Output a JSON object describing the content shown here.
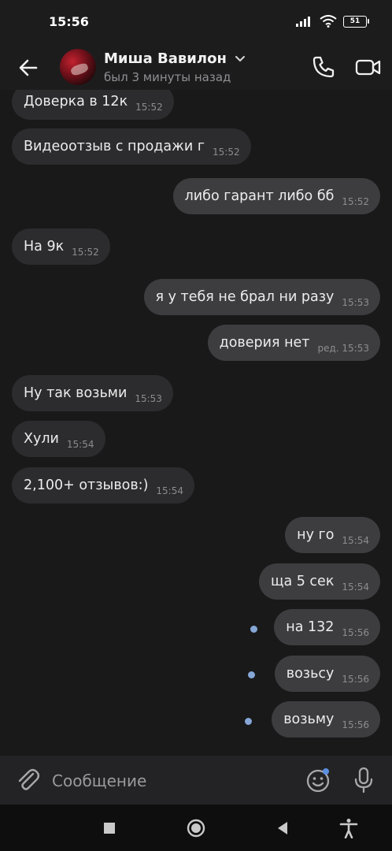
{
  "status_bar": {
    "time": "15:56",
    "battery": "51"
  },
  "header": {
    "contact_name": "Миша Вавилон",
    "contact_status": "был 3 минуты назад"
  },
  "messages": [
    {
      "dir": "in",
      "text": "Доверка в 12к",
      "time": "15:52"
    },
    {
      "dir": "in",
      "text": "Видеоотзыв с продажи г",
      "time": "15:52"
    },
    {
      "dir": "out",
      "text": "либо гарант либо бб",
      "time": "15:52"
    },
    {
      "dir": "in",
      "text": "На 9к",
      "time": "15:52"
    },
    {
      "dir": "out",
      "text": "я у тебя не брал ни разу",
      "time": "15:53"
    },
    {
      "dir": "out",
      "text": "доверия нет",
      "time": "ред. 15:53"
    },
    {
      "dir": "in",
      "text": "Ну так возьми",
      "time": "15:53"
    },
    {
      "dir": "in",
      "text": "Хули",
      "time": "15:54"
    },
    {
      "dir": "in",
      "text": "2,100+ отзывов:)",
      "time": "15:54"
    },
    {
      "dir": "out",
      "text": "ну го",
      "time": "15:54"
    },
    {
      "dir": "out",
      "text": "ща 5 сек",
      "time": "15:54"
    },
    {
      "dir": "out",
      "text": "на 132",
      "time": "15:56",
      "unread": true
    },
    {
      "dir": "out",
      "text": "возьсу",
      "time": "15:56",
      "unread": true
    },
    {
      "dir": "out",
      "text": "возьму",
      "time": "15:56",
      "unread": true
    }
  ],
  "composer": {
    "placeholder": "Сообщение"
  },
  "icons": {
    "back": "arrow-left-icon",
    "call": "phone-icon",
    "video": "video-camera-icon",
    "attach": "paperclip-icon",
    "emoji": "smiley-icon",
    "mic": "microphone-icon",
    "nav": [
      "square-icon",
      "circle-icon",
      "triangle-back-icon",
      "accessibility-icon"
    ]
  },
  "colors": {
    "background": "#19191a",
    "incoming_bubble": "#2c2c2e",
    "outgoing_bubble": "#3d3d40",
    "unread_dot": "#86a7d6",
    "emoji_badge": "#5b8fe0"
  }
}
